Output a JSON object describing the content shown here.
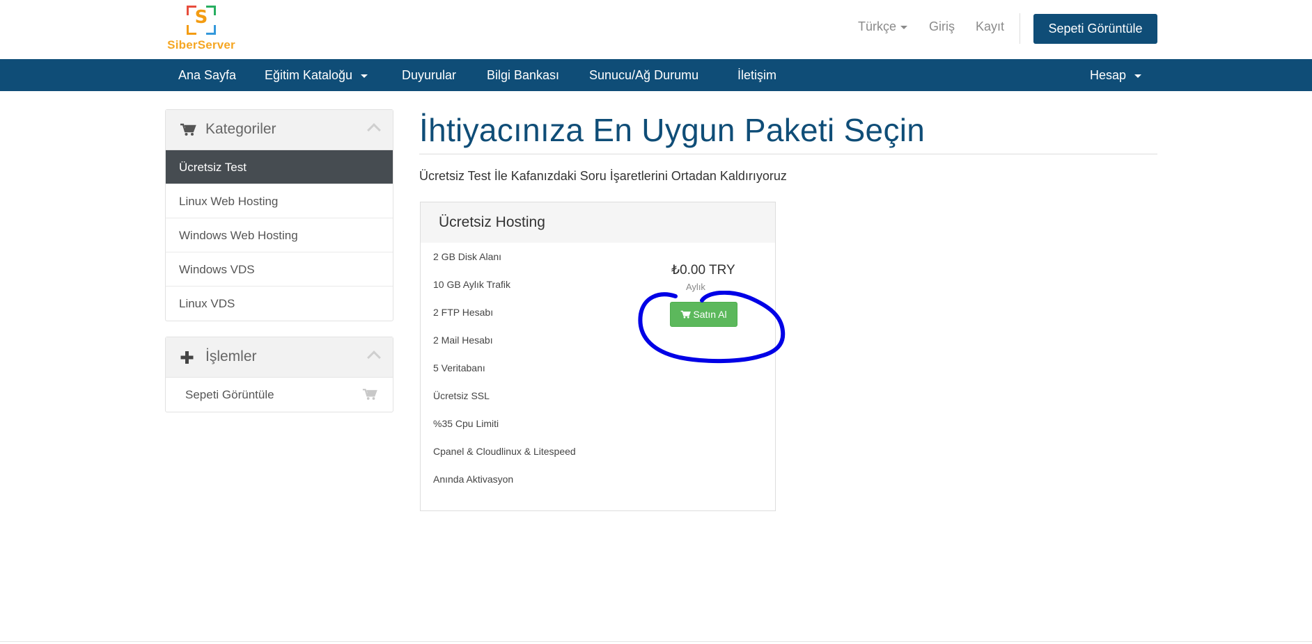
{
  "header": {
    "logo_text": "SiberServer",
    "logo_letter": "S",
    "language_label": "Türkçe",
    "login_label": "Giriş",
    "register_label": "Kayıt",
    "view_cart_label": "Sepeti Görüntüle"
  },
  "nav": {
    "items": [
      {
        "label": "Ana Sayfa"
      },
      {
        "label": "Eğitim Kataloğu"
      },
      {
        "label": "Duyurular"
      },
      {
        "label": "Bilgi Bankası"
      },
      {
        "label": "Sunucu/Ağ Durumu"
      },
      {
        "label": "İletişim"
      }
    ],
    "account_label": "Hesap"
  },
  "sidebar": {
    "categories_title": "Kategoriler",
    "categories": [
      {
        "label": "Ücretsiz Test",
        "active": true
      },
      {
        "label": "Linux Web Hosting"
      },
      {
        "label": "Windows Web Hosting"
      },
      {
        "label": "Windows VDS"
      },
      {
        "label": "Linux VDS"
      }
    ],
    "actions_title": "İşlemler",
    "actions": [
      {
        "label": "Sepeti Görüntüle",
        "icon": "cart-icon"
      }
    ]
  },
  "main": {
    "title": "İhtiyacınıza En Uygun Paketi Seçin",
    "tagline": "Ücretsiz Test İle Kafanızdaki Soru İşaretlerini Ortadan Kaldırıyoruz",
    "product": {
      "name": "Ücretsiz Hosting",
      "features": [
        "2 GB Disk Alanı",
        "10 GB Aylık Trafik",
        "2 FTP Hesabı",
        "2 Mail Hesabı",
        "5 Veritabanı",
        "Ücretsiz SSL",
        "%35 Cpu Limiti",
        "Cpanel & Cloudlinux & Litespeed",
        "Anında Aktivasyon"
      ],
      "price": "₺0.00 TRY",
      "cycle": "Aylık",
      "buy_label": "Satın Al"
    }
  },
  "colors": {
    "brand_blue": "#0f4d77",
    "active_item": "#464c51",
    "buy_green": "#5cb85c",
    "annotation": "#0000e6",
    "logo_orange": "#f5a623"
  }
}
